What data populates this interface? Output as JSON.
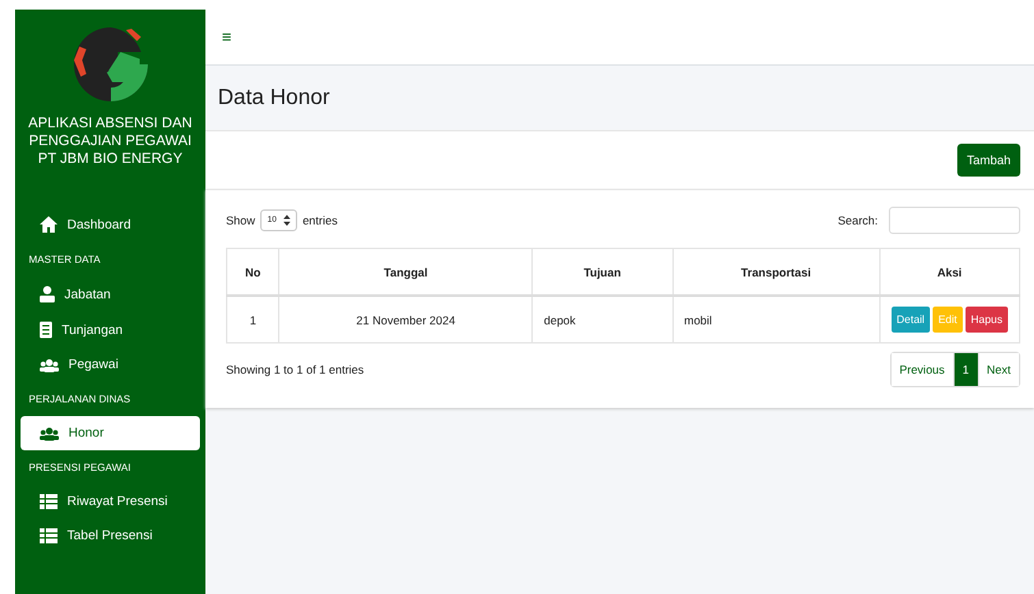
{
  "sidebar": {
    "app_title": "APLIKASI ABSENSI DAN PENGGAJIAN PEGAWAI PT JBM BIO ENERGY",
    "items": [
      {
        "kind": "link",
        "label": "Dashboard",
        "selected": false
      },
      {
        "kind": "header",
        "label": "MASTER DATA"
      },
      {
        "kind": "link",
        "label": "Jabatan",
        "selected": false
      },
      {
        "kind": "link",
        "label": "Tunjangan",
        "selected": false
      },
      {
        "kind": "link",
        "label": "Pegawai",
        "selected": false
      },
      {
        "kind": "header",
        "label": "PERJALANAN DINAS"
      },
      {
        "kind": "link",
        "label": "Honor",
        "selected": true
      },
      {
        "kind": "header",
        "label": "PRESENSI PEGAWAI"
      },
      {
        "kind": "link",
        "label": "Riwayat Presensi",
        "selected": false
      },
      {
        "kind": "link",
        "label": "Tabel Presensi",
        "selected": false
      }
    ]
  },
  "topbar": {
    "menu_glyph": "≡"
  },
  "page_title": "Data Honor",
  "add_button": "Tambah",
  "table_controls": {
    "show_label": "Show",
    "page_size": "10",
    "entries_label": "entries",
    "search_label": "Search:"
  },
  "table": {
    "columns": [
      "No",
      "Tanggal",
      "Tujuan",
      "Transportasi",
      "Aksi"
    ],
    "rows": [
      {
        "cells": [
          "1",
          "21 November 2024",
          "depok",
          "mobil"
        ],
        "actions": [
          {
            "kind": "info",
            "label": "Detail"
          },
          {
            "kind": "warning",
            "label": "Edit"
          },
          {
            "kind": "danger",
            "label": "Hapus"
          }
        ]
      }
    ]
  },
  "footer": {
    "info": "Showing 1 to 1 of 1 entries",
    "pagination": [
      {
        "label": "Previous",
        "selected": false
      },
      {
        "label": "1",
        "selected": true
      },
      {
        "label": "Next",
        "selected": false
      }
    ]
  }
}
